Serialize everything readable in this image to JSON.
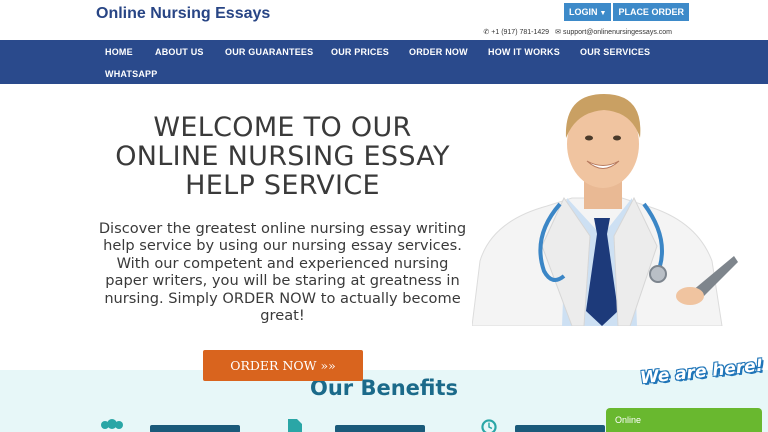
{
  "header": {
    "site_title": "Online Nursing Essays",
    "login_label": "LOGIN",
    "place_order_label": "PLACE ORDER",
    "phone": "+1 (917) 781-1429",
    "email": "support@onlinenursingessays.com"
  },
  "nav": {
    "items": [
      {
        "label": "HOME"
      },
      {
        "label": "ABOUT US"
      },
      {
        "label": "OUR GUARANTEES"
      },
      {
        "label": "OUR PRICES"
      },
      {
        "label": "ORDER NOW"
      },
      {
        "label": "HOW IT WORKS"
      },
      {
        "label": "OUR SERVICES"
      },
      {
        "label": "WHATSAPP"
      }
    ]
  },
  "hero": {
    "title_line1": "WELCOME TO OUR",
    "title_line2": "ONLINE NURSING ESSAY",
    "title_line3": "HELP SERVICE",
    "description": "Discover the greatest online nursing essay writing help service by using our nursing essay services. With our competent and experienced nursing paper writers, you will be staring at greatness in nursing. Simply ORDER NOW to actually become great!",
    "order_button": "ORDER NOW »»"
  },
  "benefits": {
    "title": "Our Benefits"
  },
  "chat": {
    "badge": "We are here!",
    "status": "Online"
  },
  "colors": {
    "brand_blue": "#2a4a8c",
    "button_blue": "#3d8ac9",
    "order_orange": "#d9641e",
    "chat_green": "#69b82f",
    "benefits_bg": "#e7f7f8"
  },
  "icons": [
    "phone-icon",
    "email-icon",
    "caret-down-icon",
    "users-icon",
    "document-icon",
    "clock-icon"
  ]
}
